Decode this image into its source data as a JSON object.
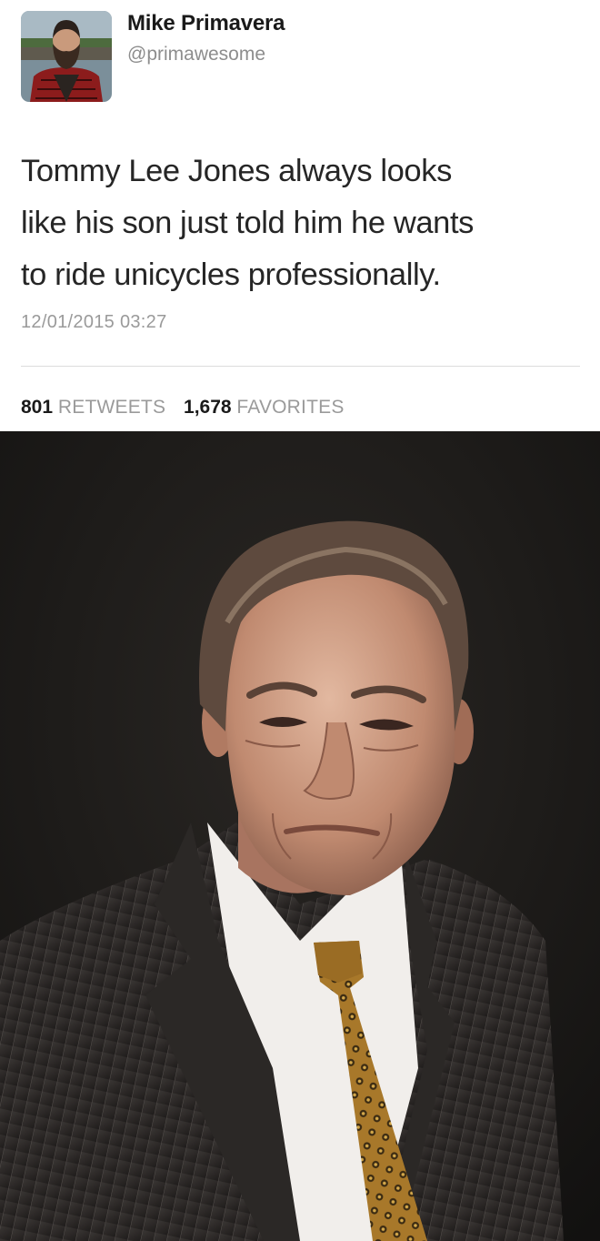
{
  "tweet": {
    "author": {
      "display_name": "Mike Primavera",
      "handle": "@primawesome",
      "avatar_icon": "user-avatar-photo"
    },
    "text_lines": [
      "Tommy Lee Jones always looks",
      "like his son just told him he wants",
      "to ride unicycles professionally."
    ],
    "timestamp": "12/01/2015 03:27",
    "stats": {
      "retweets_count": "801",
      "retweets_label": "RETWEETS",
      "favorites_count": "1,678",
      "favorites_label": "FAVORITES"
    }
  },
  "photo": {
    "subject": "portrait-man-in-suit",
    "colors": {
      "background": "#1c1a18",
      "suit": "#2e2b2a",
      "shirt": "#f2efec",
      "tie": "#b8862e"
    }
  }
}
